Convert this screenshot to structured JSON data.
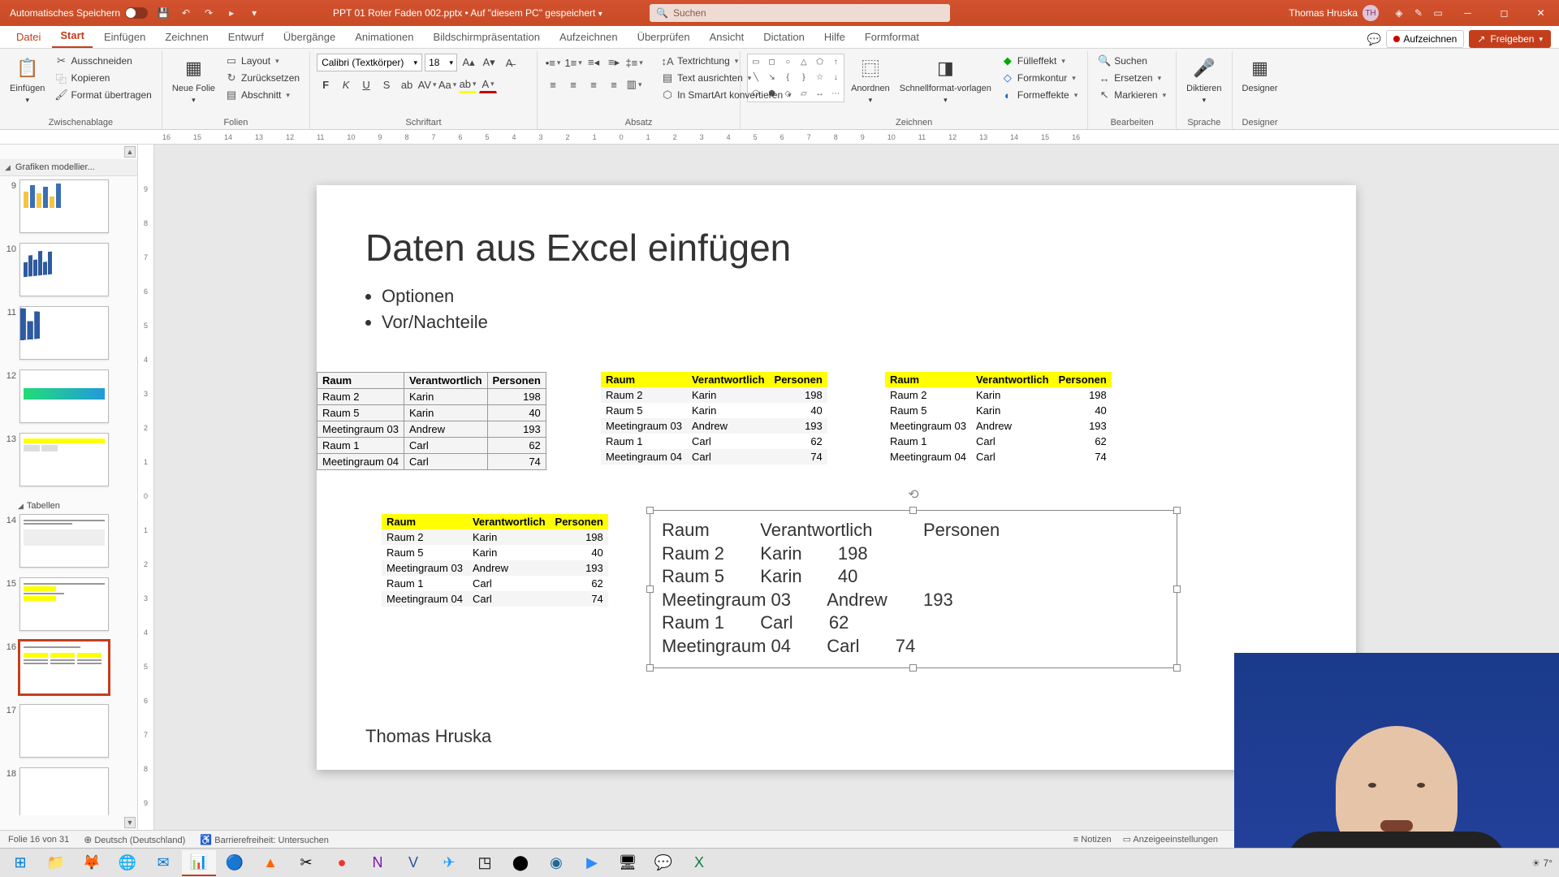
{
  "titlebar": {
    "autosave_label": "Automatisches Speichern",
    "doc_name": "PPT 01 Roter Faden 002.pptx • Auf \"diesem PC\" gespeichert",
    "search_placeholder": "Suchen",
    "user_name": "Thomas Hruska",
    "user_initials": "TH"
  },
  "tabs": {
    "file": "Datei",
    "items": [
      "Start",
      "Einfügen",
      "Zeichnen",
      "Entwurf",
      "Übergänge",
      "Animationen",
      "Bildschirmpräsentation",
      "Aufzeichnen",
      "Überprüfen",
      "Ansicht",
      "Dictation",
      "Hilfe",
      "Formformat"
    ],
    "active_index": 0,
    "record": "Aufzeichnen",
    "share": "Freigeben"
  },
  "ribbon": {
    "paste": "Einfügen",
    "cut": "Ausschneiden",
    "copy": "Kopieren",
    "format_painter": "Format übertragen",
    "group_clipboard": "Zwischenablage",
    "new_slide": "Neue Folie",
    "layout": "Layout",
    "reset": "Zurücksetzen",
    "section": "Abschnitt",
    "group_slides": "Folien",
    "font_name": "Calibri (Textkörper)",
    "font_size": "18",
    "group_font": "Schriftart",
    "group_paragraph": "Absatz",
    "text_direction": "Textrichtung",
    "align_text": "Text ausrichten",
    "convert_smartart": "In SmartArt konvertieren",
    "arrange": "Anordnen",
    "quick_styles": "Schnellformat-vorlagen",
    "shape_fill": "Fülleffekt",
    "shape_outline": "Formkontur",
    "shape_effects": "Formeffekte",
    "group_drawing": "Zeichnen",
    "find": "Suchen",
    "replace": "Ersetzen",
    "select": "Markieren",
    "group_editing": "Bearbeiten",
    "dictate": "Diktieren",
    "group_voice": "Sprache",
    "designer": "Designer",
    "group_designer": "Designer"
  },
  "ruler": [
    "16",
    "15",
    "14",
    "13",
    "12",
    "11",
    "10",
    "9",
    "8",
    "7",
    "6",
    "5",
    "4",
    "3",
    "2",
    "1",
    "0",
    "1",
    "2",
    "3",
    "4",
    "5",
    "6",
    "7",
    "8",
    "9",
    "10",
    "11",
    "12",
    "13",
    "14",
    "15",
    "16"
  ],
  "ruler_v": [
    "9",
    "8",
    "7",
    "6",
    "5",
    "4",
    "3",
    "2",
    "1",
    "0",
    "1",
    "2",
    "3",
    "4",
    "5",
    "6",
    "7",
    "8",
    "9"
  ],
  "panel": {
    "section1": "Grafiken modellier...",
    "section2": "Tabellen",
    "thumbs": [
      "9",
      "10",
      "11",
      "12",
      "13",
      "14",
      "15",
      "16",
      "17",
      "18"
    ],
    "selected": "16"
  },
  "slide": {
    "title": "Daten aus Excel einfügen",
    "bullets": [
      "Optionen",
      "Vor/Nachteile"
    ],
    "headers": {
      "raum": "Raum",
      "verantwortlich": "Verantwortlich",
      "personen": "Personen"
    },
    "rows": [
      {
        "raum": "Raum 2",
        "ver": "Karin",
        "per": "198"
      },
      {
        "raum": "Raum 5",
        "ver": "Karin",
        "per": "40"
      },
      {
        "raum": "Meetingraum 03",
        "ver": "Andrew",
        "per": "193"
      },
      {
        "raum": "Raum 1",
        "ver": "Carl",
        "per": "62"
      },
      {
        "raum": "Meetingraum 04",
        "ver": "Carl",
        "per": "74"
      }
    ],
    "footer_author": "Thomas Hruska"
  },
  "statusbar": {
    "slide_info": "Folie 16 von 31",
    "language": "Deutsch (Deutschland)",
    "accessibility": "Barrierefreiheit: Untersuchen",
    "notes": "Notizen",
    "display_settings": "Anzeigeeinstellungen"
  },
  "tray": {
    "temp": "7°"
  }
}
